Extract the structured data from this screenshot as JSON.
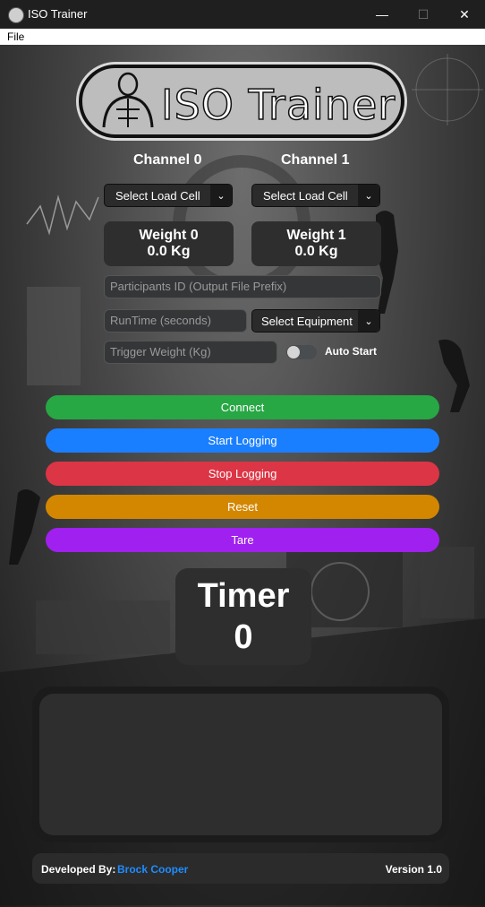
{
  "window": {
    "title": "ISO Trainer",
    "minimize_glyph": "—",
    "maximize_glyph": "☐",
    "close_glyph": "✕"
  },
  "menu": {
    "file": "File"
  },
  "logo": {
    "text": "ISO Trainer"
  },
  "channels": [
    {
      "label": "Channel 0",
      "select": "Select Load Cell",
      "weight_title": "Weight 0",
      "weight_value": "0.0 Kg"
    },
    {
      "label": "Channel 1",
      "select": "Select Load Cell",
      "weight_title": "Weight 1",
      "weight_value": "0.0 Kg"
    }
  ],
  "fields": {
    "participant_placeholder": "Participants ID (Output File Prefix)",
    "runtime_placeholder": "RunTime (seconds)",
    "trigger_placeholder": "Trigger Weight (Kg)"
  },
  "equipment": {
    "select": "Select Equipment"
  },
  "auto_start": {
    "label": "Auto Start"
  },
  "buttons": {
    "connect": "Connect",
    "start_logging": "Start Logging",
    "stop_logging": "Stop Logging",
    "reset": "Reset",
    "tare": "Tare"
  },
  "timer": {
    "title": "Timer",
    "value": "0"
  },
  "footer": {
    "developed_by": "Developed By:",
    "developer": "Brock Cooper",
    "version": "Version 1.0"
  },
  "colors": {
    "connect": "#28a745",
    "start_logging": "#1a7fff",
    "stop_logging": "#dc3545",
    "reset": "#d38700",
    "tare": "#a020f0",
    "developer_link": "#1f8cff"
  },
  "icons": {
    "dropdown": "chevron-down-icon",
    "app": "app-icon"
  }
}
